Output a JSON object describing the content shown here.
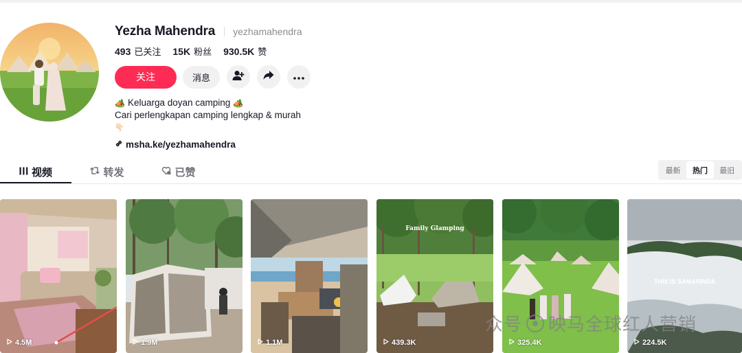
{
  "profile": {
    "display_name": "Yezha Mahendra",
    "username": "yezhamahendra",
    "stats": [
      {
        "value": "493",
        "label": "已关注"
      },
      {
        "value": "15K",
        "label": "粉丝"
      },
      {
        "value": "930.5K",
        "label": "赞"
      }
    ],
    "follow_label": "关注",
    "message_label": "消息",
    "bio_line1": "Keluarga doyan camping",
    "bio_line2": "Cari perlengkapan camping lengkap & murah",
    "bio_emoji": "🏕️",
    "bio_pointer": "👇🏻",
    "link": "msha.ke/yezhamahendra"
  },
  "tabs": [
    {
      "label": "视频",
      "icon": "grid-icon",
      "active": true
    },
    {
      "label": "转发",
      "icon": "repost-icon",
      "active": false
    },
    {
      "label": "已赞",
      "icon": "heart-icon",
      "active": false
    }
  ],
  "sort": [
    {
      "label": "最新",
      "active": false
    },
    {
      "label": "热门",
      "active": true
    },
    {
      "label": "最旧",
      "active": false
    }
  ],
  "videos": [
    {
      "views": "4.5M"
    },
    {
      "views": "1.9M"
    },
    {
      "views": "1.1M"
    },
    {
      "views": "439.3K",
      "caption": "Family Glamping"
    },
    {
      "views": "325.4K"
    },
    {
      "views": "224.5K",
      "caption": "THIS IS SAMARINDA"
    }
  ],
  "watermark": {
    "left": "众号",
    "right": "映马全球红人营销"
  },
  "colors": {
    "accent": "#fe2c55",
    "text_primary": "#161823",
    "text_secondary": "#73747b"
  }
}
